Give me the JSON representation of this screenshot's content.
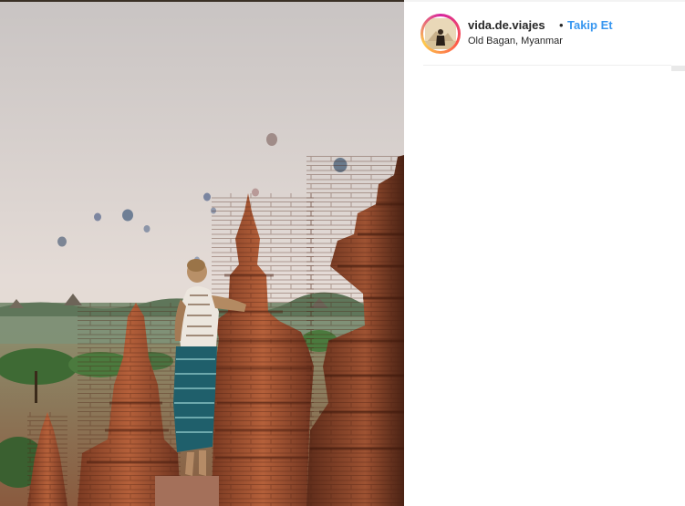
{
  "post": {
    "image": {
      "icon": "photo-image",
      "subject": "balloons-over-temples"
    },
    "header": {
      "username": "vida.de.viajes",
      "separator": "•",
      "follow_label": "Takip Et",
      "location": "Old Bagan, Myanmar"
    },
    "colors": {
      "follow": "#3897f0",
      "text": "#262626",
      "divider": "#efefef"
    }
  }
}
